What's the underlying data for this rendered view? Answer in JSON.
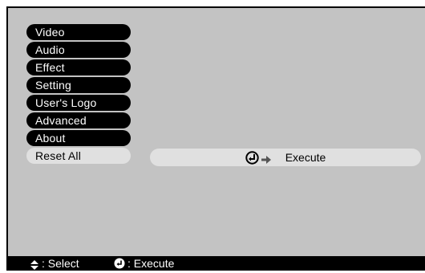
{
  "menu": {
    "items": [
      {
        "label": "Video"
      },
      {
        "label": "Audio"
      },
      {
        "label": "Effect"
      },
      {
        "label": "Setting"
      },
      {
        "label": "User's Logo"
      },
      {
        "label": "Advanced"
      },
      {
        "label": "About"
      },
      {
        "label": "Reset All"
      }
    ],
    "selected_label": "Reset All"
  },
  "submenu": {
    "execute_label": "Execute",
    "enter_icon": "enter-button-icon",
    "arrow_icon": "right-arrow-icon"
  },
  "status_bar": {
    "select_text": ": Select",
    "execute_text": ": Execute",
    "select_icon": "up-down-arrows-icon",
    "execute_icon": "enter-button-icon"
  },
  "colors": {
    "menu_background": "#c3c3c3",
    "menu_item": "#000000",
    "menu_item_selected": "#e0e0e0",
    "status_bar": "#000000"
  }
}
